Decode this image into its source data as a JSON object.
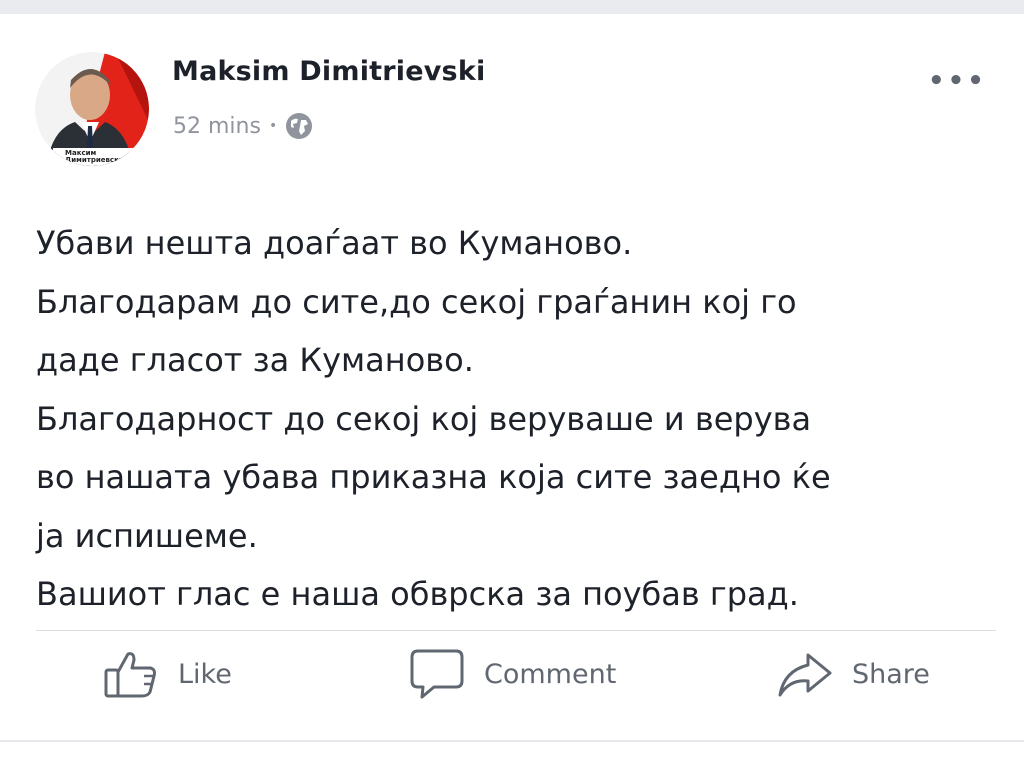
{
  "post": {
    "author": "Maksim Dimitrievski",
    "time": "52 mins",
    "separator": "•",
    "privacy_icon": "globe-icon",
    "more_label": "•••",
    "avatar_caption_line1": "Максим",
    "avatar_caption_line2": "Димитриевски",
    "lines": [
      "Убави нешта доаѓаат во Куманово.",
      "Благодарам до сите,до секој граѓанин кој го",
      "даде гласот за Куманово.",
      "Благодарност до секој кој веруваше и верува",
      "во нашата убава приказна која сите заедно ќе",
      "ја испишеме.",
      "Вашиот глас е наша обврска за поубав град."
    ]
  },
  "actions": {
    "like_label": "Like",
    "comment_label": "Comment",
    "share_label": "Share"
  },
  "colors": {
    "text": "#1d2129",
    "muted": "#90949c",
    "icon": "#606770",
    "avatar_red": "#e2231a"
  }
}
